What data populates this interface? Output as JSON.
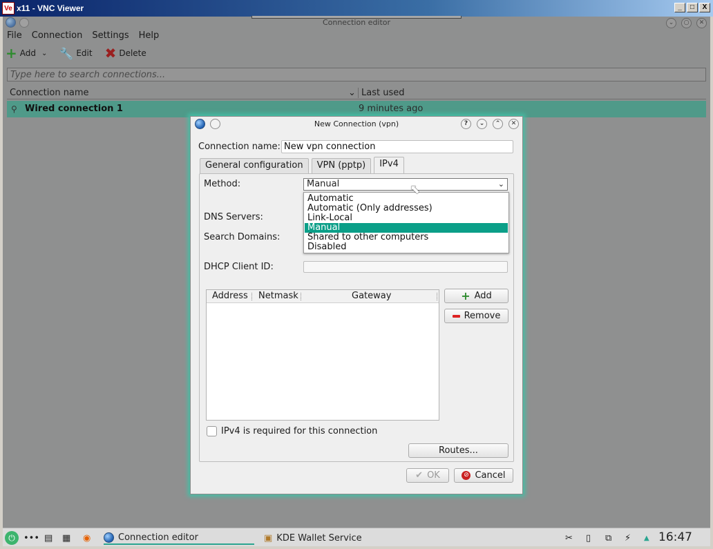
{
  "vnc": {
    "logo": "Ve",
    "title": "x11 - VNC Viewer",
    "btn_min": "_",
    "btn_max": "□",
    "btn_close": "X"
  },
  "app": {
    "title": "Connection editor",
    "menu": [
      "File",
      "Connection",
      "Settings",
      "Help"
    ],
    "toolbar": {
      "add": "Add",
      "edit": "Edit",
      "delete": "Delete"
    },
    "search_placeholder": "Type here to search connections...",
    "columns": {
      "name": "Connection name",
      "last_used": "Last used"
    },
    "rows": [
      {
        "name": "Wired connection 1",
        "last_used": "9 minutes ago"
      }
    ]
  },
  "dialog": {
    "title": "New Connection (vpn)",
    "help": "?",
    "connection_name_label": "Connection name:",
    "connection_name_value": "New vpn connection",
    "tabs": [
      "General configuration",
      "VPN (pptp)",
      "IPv4"
    ],
    "active_tab": "IPv4",
    "method_label": "Method:",
    "method_value": "Manual",
    "method_options": [
      "Automatic",
      "Automatic (Only addresses)",
      "Link-Local",
      "Manual",
      "Shared to other computers",
      "Disabled"
    ],
    "dns_label": "DNS Servers:",
    "search_domains_label": "Search Domains:",
    "dhcp_label": "DHCP Client ID:",
    "table_columns": [
      "Address",
      "Netmask",
      "Gateway"
    ],
    "add_label": "Add",
    "remove_label": "Remove",
    "ipv4_required_label": "IPv4 is required for this connection",
    "routes_label": "Routes...",
    "ok_label": "OK",
    "cancel_label": "Cancel"
  },
  "taskbar": {
    "dots": "•••",
    "items": [
      "Connection editor",
      "KDE Wallet Service"
    ],
    "clock": "16:47"
  },
  "colors": {
    "accent": "#0b9f88",
    "selection_row": "#4f9a89",
    "glow": "#43bfa6"
  }
}
